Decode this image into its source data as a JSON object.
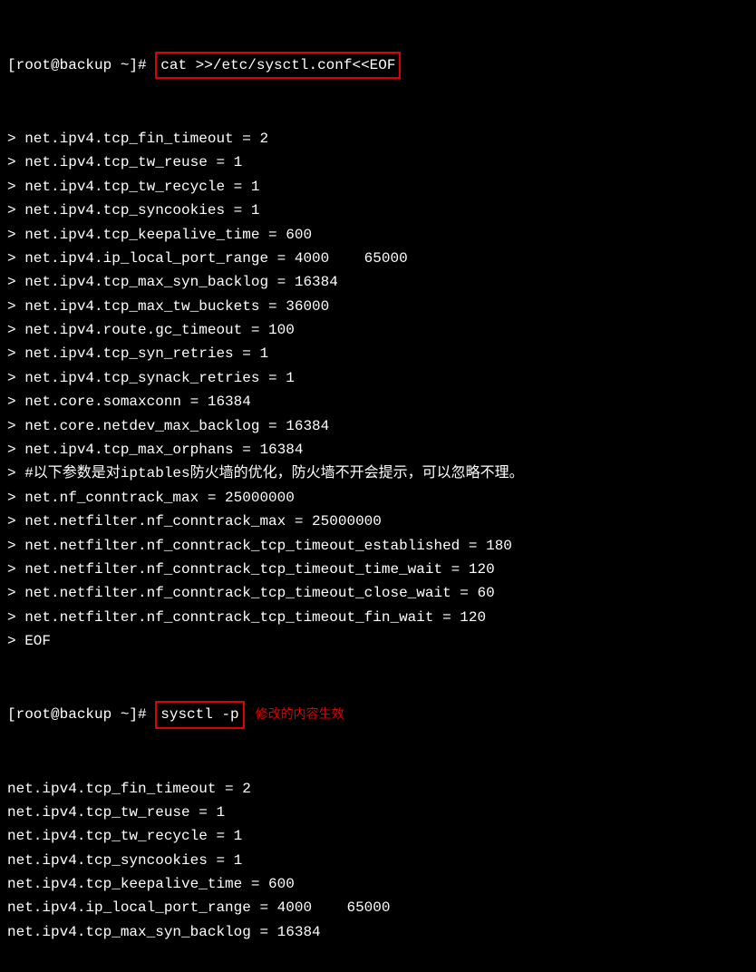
{
  "prompt1_prefix": "[root@backup ~]# ",
  "cmd1": "cat >>/etc/sysctl.conf<<EOF",
  "heredoc_lines": [
    "> net.ipv4.tcp_fin_timeout = 2",
    "> net.ipv4.tcp_tw_reuse = 1",
    "> net.ipv4.tcp_tw_recycle = 1",
    "> net.ipv4.tcp_syncookies = 1",
    "> net.ipv4.tcp_keepalive_time = 600",
    "> net.ipv4.ip_local_port_range = 4000    65000",
    "> net.ipv4.tcp_max_syn_backlog = 16384",
    "> net.ipv4.tcp_max_tw_buckets = 36000",
    "> net.ipv4.route.gc_timeout = 100",
    "> net.ipv4.tcp_syn_retries = 1",
    "> net.ipv4.tcp_synack_retries = 1",
    "> net.core.somaxconn = 16384",
    "> net.core.netdev_max_backlog = 16384",
    "> net.ipv4.tcp_max_orphans = 16384",
    "> #以下参数是对iptables防火墙的优化，防火墙不开会提示，可以忽略不理。",
    "> net.nf_conntrack_max = 25000000",
    "> net.netfilter.nf_conntrack_max = 25000000",
    "> net.netfilter.nf_conntrack_tcp_timeout_established = 180",
    "> net.netfilter.nf_conntrack_tcp_timeout_time_wait = 120",
    "> net.netfilter.nf_conntrack_tcp_timeout_close_wait = 60",
    "> net.netfilter.nf_conntrack_tcp_timeout_fin_wait = 120",
    "> EOF"
  ],
  "prompt2_prefix": "[root@backup ~]# ",
  "cmd2": "sysctl -p",
  "annotation": "修改的内容生效",
  "output_lines": [
    "net.ipv4.tcp_fin_timeout = 2",
    "net.ipv4.tcp_tw_reuse = 1",
    "net.ipv4.tcp_tw_recycle = 1",
    "net.ipv4.tcp_syncookies = 1",
    "net.ipv4.tcp_keepalive_time = 600",
    "net.ipv4.ip_local_port_range = 4000    65000",
    "net.ipv4.tcp_max_syn_backlog = 16384"
  ]
}
